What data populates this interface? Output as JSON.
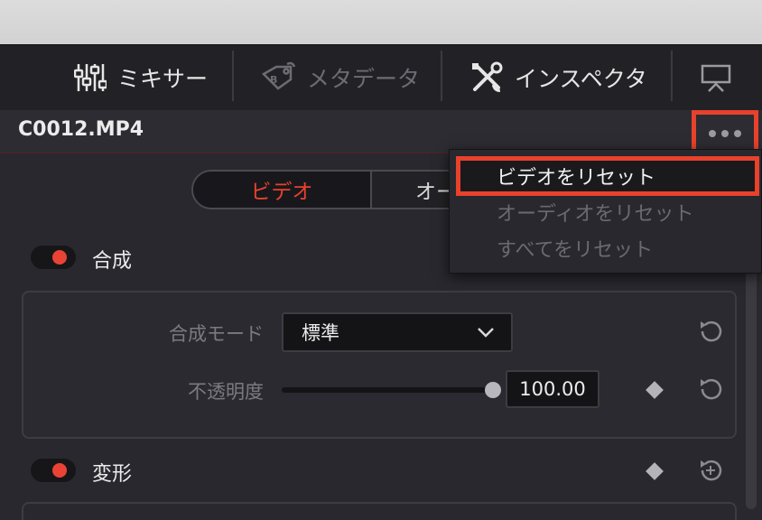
{
  "toolbar": {
    "items": [
      {
        "label": "ミキサー",
        "icon": "mixer-icon"
      },
      {
        "label": "メタデータ",
        "icon": "metadata-tag-icon"
      },
      {
        "label": "インスペクタ",
        "icon": "inspector-tools-icon"
      }
    ],
    "display_icon": "monitor-icon"
  },
  "clip": {
    "name": "C0012.MP4"
  },
  "tabs": {
    "video": "ビデオ",
    "audio": "オー"
  },
  "composite": {
    "title": "合成",
    "mode_label": "合成モード",
    "mode_value": "標準",
    "opacity_label": "不透明度",
    "opacity_value": "100.00",
    "opacity_fraction": 1.0
  },
  "transform": {
    "title": "変形"
  },
  "menu": {
    "items": [
      {
        "label": "ビデオをリセット",
        "state": "active"
      },
      {
        "label": "オーディオをリセット",
        "state": "disabled"
      },
      {
        "label": "すべてをリセット",
        "state": "disabled"
      }
    ]
  },
  "colors": {
    "accent": "#e8412c",
    "toggle_on": "#ea4335",
    "panel_bg": "#28282e"
  }
}
